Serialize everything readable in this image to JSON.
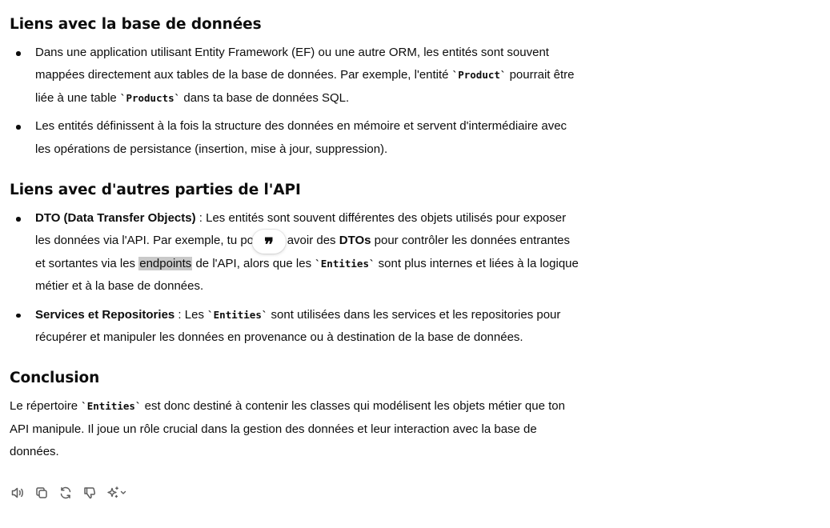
{
  "sections": [
    {
      "heading": "Liens avec la base de données",
      "bullets": [
        {
          "t1": "Dans une application utilisant Entity Framework (EF) ou une autre ORM, les entités sont souvent mappées directement aux tables de la base de données. Par exemple, l'entité ",
          "c1": "`Product`",
          "t2": " pourrait être liée à une table ",
          "c2": "`Products`",
          "t3": " dans ta base de données SQL."
        },
        {
          "t1": "Les entités définissent à la fois la structure des données en mémoire et servent d'intermédiaire avec les opérations de persistance (insertion, mise à jour, suppression)."
        }
      ]
    },
    {
      "heading": "Liens avec d'autres parties de l'API",
      "bullets": [
        {
          "b1": "DTO (Data Transfer Objects)",
          "t1": " : Les entités sont souvent différentes des objets utilisés pour exposer les données via l'API. Par exemple, tu pourrais avoir des ",
          "b2": "DTOs",
          "t2": " pour contrôler les données entrantes et sortantes via les ",
          "hl": "endpoints",
          "t3": " de l'API, alors que les ",
          "c1": "`Entities`",
          "t4": " sont plus internes et liées à la logique métier et à la base de données."
        },
        {
          "b1": "Services et Repositories",
          "t1": " : Les ",
          "c1": "`Entities`",
          "t2": " sont utilisées dans les services et les repositories pour récupérer et manipuler les données en provenance ou à destination de la base de données."
        }
      ]
    },
    {
      "heading": "Conclusion",
      "paragraph": {
        "t1": "Le répertoire ",
        "c1": "`Entities`",
        "t2": " est donc destiné à contenir les classes qui modélisent les objets métier que ton API manipule. Il joue un rôle crucial dans la gestion des données et leur interaction avec la base de données."
      }
    }
  ],
  "quote_popup": {
    "glyph": "❞",
    "icon": "quote-icon"
  },
  "toolbar": {
    "buttons": [
      "read-aloud-icon",
      "copy-icon",
      "regenerate-icon",
      "thumbs-down-icon",
      "sparkle-model-icon"
    ]
  },
  "colors": {
    "text": "#0d0d0d",
    "highlight": "#c9c9c9",
    "icon": "#5d5d5d"
  }
}
